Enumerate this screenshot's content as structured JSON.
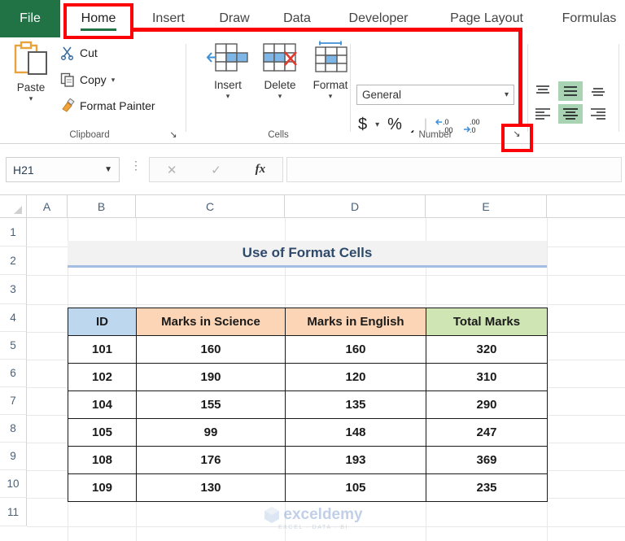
{
  "ribbon": {
    "file_tab": "File",
    "tabs": [
      {
        "label": "Home",
        "active": true
      },
      {
        "label": "Insert",
        "active": false
      },
      {
        "label": "Draw",
        "active": false
      },
      {
        "label": "Data",
        "active": false
      },
      {
        "label": "Developer",
        "active": false
      },
      {
        "label": "Page Layout",
        "active": false
      },
      {
        "label": "Formulas",
        "active": false
      }
    ],
    "clipboard": {
      "group_label": "Clipboard",
      "paste_label": "Paste",
      "cut_label": "Cut",
      "copy_label": "Copy",
      "format_painter_label": "Format Painter",
      "launcher_glyph": "↘"
    },
    "cells": {
      "group_label": "Cells",
      "insert_label": "Insert",
      "delete_label": "Delete",
      "format_label": "Format"
    },
    "number": {
      "group_label": "Number",
      "format_value": "General",
      "currency_glyph": "$",
      "percent_glyph": "%",
      "comma_glyph": "͵",
      "increase_decimal_label": ".00",
      "decrease_decimal_label": ".00",
      "launcher_glyph": "↘"
    },
    "alignment": {
      "top_align": "top-align",
      "middle_align": "middle-align",
      "bottom_align": "bottom-align",
      "left_align": "align-left",
      "center_align": "align-center",
      "right_align": "align-right"
    }
  },
  "formula_bar": {
    "name_box_value": "H21",
    "cancel_glyph": "✕",
    "enter_glyph": "✓",
    "fx_label": "fx",
    "input_value": "",
    "dots_glyph": "⋮"
  },
  "grid": {
    "columns": [
      "A",
      "B",
      "C",
      "D",
      "E"
    ],
    "rows": [
      "1",
      "2",
      "3",
      "4",
      "5",
      "6",
      "7",
      "8",
      "9",
      "10",
      "11"
    ]
  },
  "sheet": {
    "title": "Use of Format Cells",
    "table": {
      "headers": [
        "ID",
        "Marks in Science",
        "Marks in English",
        "Total Marks"
      ],
      "rows": [
        [
          "101",
          "160",
          "160",
          "320"
        ],
        [
          "102",
          "190",
          "120",
          "310"
        ],
        [
          "104",
          "155",
          "135",
          "290"
        ],
        [
          "105",
          "99",
          "148",
          "247"
        ],
        [
          "108",
          "176",
          "193",
          "369"
        ],
        [
          "109",
          "130",
          "105",
          "235"
        ]
      ]
    }
  },
  "watermark": {
    "brand": "exceldemy",
    "tagline": "EXCEL · DATA · BI"
  },
  "colors": {
    "excel_green": "#217346",
    "annotation_red": "#fb0007",
    "header_id": "#bdd7ee",
    "header_marks": "#fbd5b5",
    "header_total": "#cfe5b4",
    "title_text": "#2e4a6b",
    "align_highlight": "#a9d4b4"
  }
}
